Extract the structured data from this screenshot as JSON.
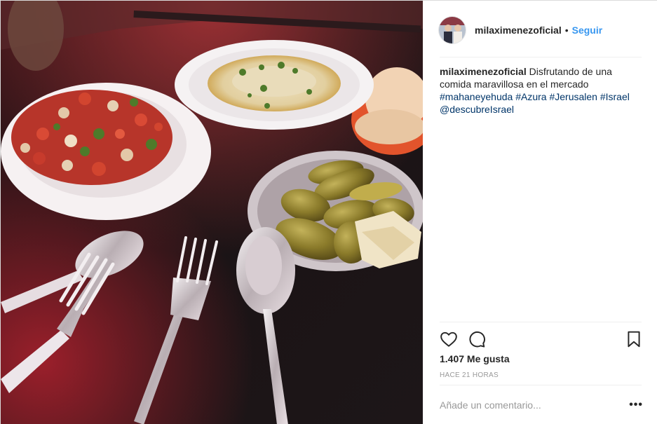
{
  "post": {
    "username": "milaximenezoficial",
    "follow_label": "Seguir",
    "separator": "•",
    "photo": {
      "description_icon": "food-photo",
      "items": [
        "salad-plate",
        "hummus-plate",
        "pickles-plate",
        "pita-bread",
        "spoon",
        "fork",
        "fork-and-spoon"
      ]
    },
    "caption": {
      "username": "milaximenezoficial",
      "text": "Disfrutando de una comida maravillosa en el mercado",
      "hashtags": [
        "#mahaneyehuda",
        "#Azura",
        "#Jerusalen",
        "#Israel"
      ],
      "mention": "@descubreIsrael"
    },
    "actions": {
      "like_icon": "heart-icon",
      "comment_icon": "comment-icon",
      "save_icon": "bookmark-icon"
    },
    "likes_text": "1.407 Me gusta",
    "time_text": "HACE 21 HORAS",
    "comment": {
      "placeholder": "Añade un comentario...",
      "more_label": "•••"
    },
    "colors": {
      "link_blue": "#3897f0",
      "hashtag": "#003569",
      "muted": "#999999",
      "text": "#262626"
    }
  }
}
